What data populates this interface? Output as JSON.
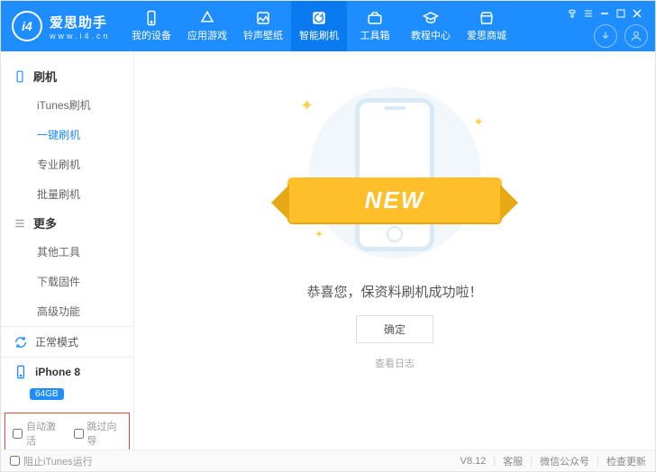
{
  "logo": {
    "initials": "i4",
    "brand": "爱思助手",
    "url": "www.i4.cn"
  },
  "tabs": [
    {
      "label": "我的设备"
    },
    {
      "label": "应用游戏"
    },
    {
      "label": "铃声壁纸"
    },
    {
      "label": "智能刷机"
    },
    {
      "label": "工具箱"
    },
    {
      "label": "教程中心"
    },
    {
      "label": "爱思商城"
    }
  ],
  "activeTab": 3,
  "sidebar": {
    "group1_label": "刷机",
    "group1": [
      {
        "label": "iTunes刷机"
      },
      {
        "label": "一键刷机"
      },
      {
        "label": "专业刷机"
      },
      {
        "label": "批量刷机"
      }
    ],
    "group1_active": 1,
    "group2_label": "更多",
    "group2": [
      {
        "label": "其他工具"
      },
      {
        "label": "下载固件"
      },
      {
        "label": "高级功能"
      }
    ],
    "mode_label": "正常模式",
    "device_name": "iPhone 8",
    "device_storage": "64GB",
    "check_auto_activate": "自动激活",
    "check_skip_guide": "跳过向导"
  },
  "main": {
    "ribbon": "NEW",
    "message": "恭喜您，保资料刷机成功啦！",
    "ok_btn": "确定",
    "log_link": "查看日志"
  },
  "statusbar": {
    "block_itunes": "阻止iTunes运行",
    "version": "V8.12",
    "support": "客服",
    "wechat": "微信公众号",
    "update": "检查更新"
  }
}
